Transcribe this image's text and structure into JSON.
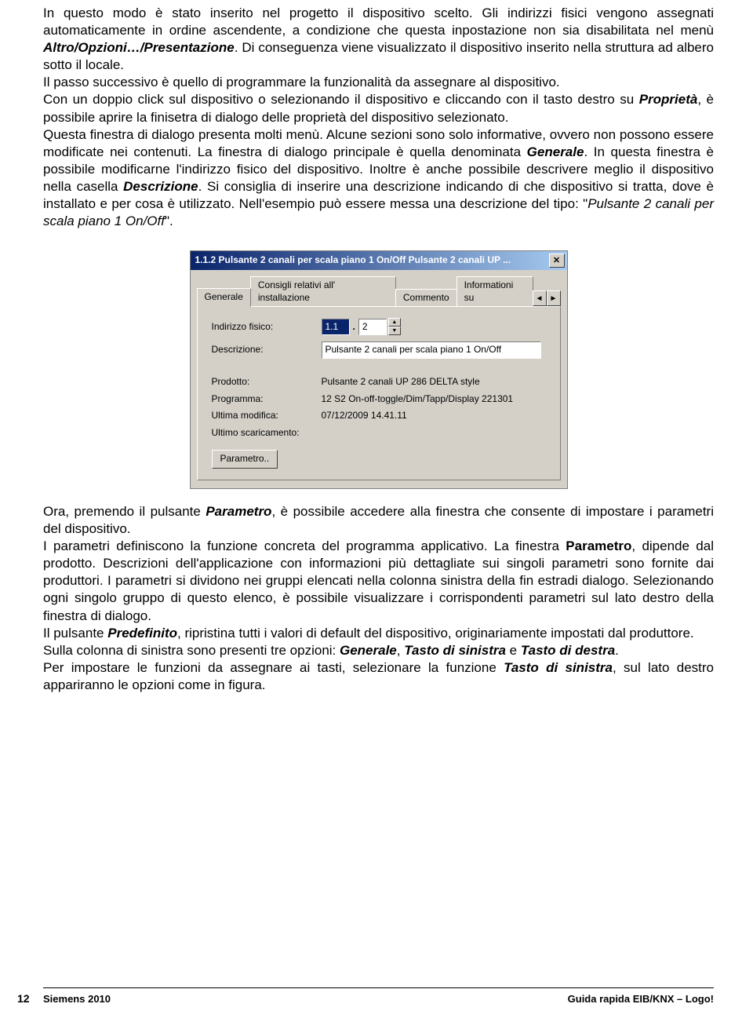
{
  "body": {
    "p1_a": "In questo modo è stato inserito nel progetto il dispositivo scelto. Gli indirizzi fisici vengono assegnati automaticamente in ordine ascendente, a condizione che questa inpostazione non sia disabilitata nel menù ",
    "p1_b": "Altro/Opzioni…/Presentazione",
    "p1_c": ". Di conseguenza viene visualizzato il dispositivo inserito nella struttura ad albero sotto il locale.",
    "p2": "Il passo successivo è quello di programmare la funzionalità da assegnare al dispositivo.",
    "p3_a": "Con un doppio click sul dispositivo o selezionando il dispositivo e cliccando con il tasto destro su ",
    "p3_b": "Proprietà",
    "p3_c": ", è possibile aprire la finisetra di dialogo delle proprietà del dispositivo selezionato.",
    "p4_a": "Questa finestra di dialogo presenta molti menù. Alcune sezioni sono solo informative, ovvero non possono essere modificate nei contenuti. La finestra di dialogo principale è quella denominata ",
    "p4_b": "Generale",
    "p4_c": ". In questa finestra è possibile modificarne l'indirizzo fisico del dispositivo. Inoltre è anche possibile descrivere meglio il dispositivo nella casella ",
    "p4_d": "Descrizione",
    "p4_e": ". Si consiglia di inserire una descrizione indicando di che dispositivo si tratta, dove è installato e per cosa è utilizzato. Nell'esempio può essere messa una descrizione del tipo: \"",
    "p4_f": "Pulsante 2 canali per scala piano 1 On/Off",
    "p4_g": "\"."
  },
  "dialog": {
    "title": "1.1.2 Pulsante 2 canali per scala piano 1 On/Off Pulsante 2 canali UP ...",
    "tabs": [
      "Generale",
      "Consigli relativi all' installazione",
      "Commento",
      "Informationi su"
    ],
    "labels": {
      "indirizzo": "Indirizzo fisico:",
      "descrizione": "Descrizione:",
      "prodotto": "Prodotto:",
      "programma": "Programma:",
      "ultima_mod": "Ultima modifica:",
      "ultimo_scar": "Ultimo scaricamento:"
    },
    "values": {
      "addr1": "1.1",
      "addr2": "2",
      "descrizione": "Pulsante 2 canali per scala piano 1 On/Off",
      "prodotto": "Pulsante 2 canali UP 286 DELTA style",
      "programma": "12 S2 On-off-toggle/Dim/Tapp/Display 221301",
      "ultima_mod": "07/12/2009 14.41.11",
      "ultimo_scar": ""
    },
    "parametro_btn": "Parametro.."
  },
  "body2": {
    "p5_a": "Ora, premendo il pulsante ",
    "p5_b": "Parametro",
    "p5_c": ", è possibile accedere alla finestra che consente di impostare i parametri del dispositivo.",
    "p6_a": "I parametri definiscono la funzione concreta del programma applicativo. La finestra ",
    "p6_b": "Parametro",
    "p6_c": ", dipende dal prodotto. Descrizioni dell'applicazione con informazioni più dettagliate sui singoli parametri sono fornite dai produttori. I parametri si dividono nei gruppi elencati nella colonna sinistra della fin estradi dialogo. Selezionando ogni singolo gruppo di questo elenco, è possibile visualizzare i corrispondenti parametri sul lato destro della finestra di dialogo.",
    "p7_a": "Il pulsante ",
    "p7_b": "Predefinito",
    "p7_c": ", ripristina tutti i valori di default del dispositivo, originariamente impostati dal produttore.",
    "p8_a": "Sulla colonna di sinistra sono presenti tre opzioni: ",
    "p8_b": "Generale",
    "p8_c": ", ",
    "p8_d": "Tasto di sinistra",
    "p8_e": " e ",
    "p8_f": "Tasto di destra",
    "p8_g": ".",
    "p9_a": "Per impostare le funzioni da assegnare ai tasti, selezionare la funzione ",
    "p9_b": "Tasto di sinistra",
    "p9_c": ", sul lato destro appariranno le opzioni come in figura."
  },
  "footer": {
    "page": "12",
    "left": "Siemens 2010",
    "right": "Guida rapida EIB/KNX – Logo!"
  }
}
